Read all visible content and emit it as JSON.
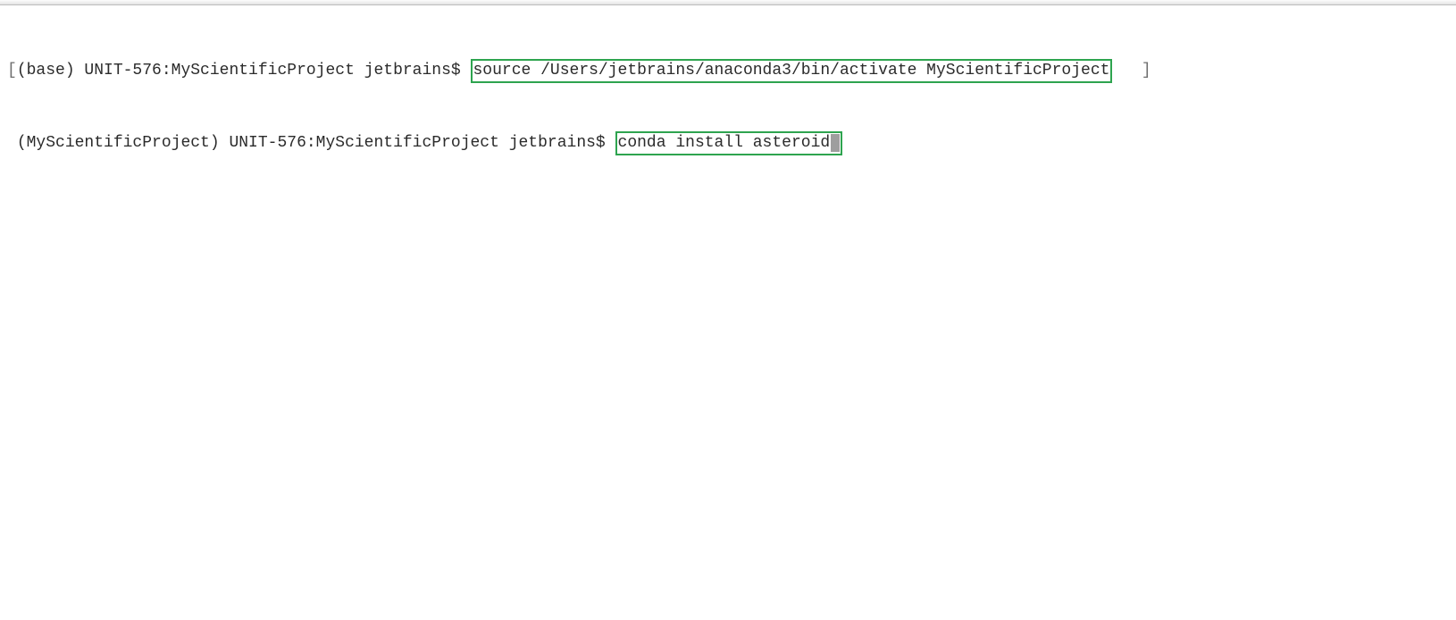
{
  "lines": [
    {
      "open_bracket": "[",
      "prompt": "(base) UNIT-576:MyScientificProject jetbrains$ ",
      "command": "source /Users/jetbrains/anaconda3/bin/activate MyScientificProject",
      "close_bracket": "]",
      "has_box": true,
      "right_bracket_gap": "   "
    },
    {
      "open_bracket": " ",
      "prompt": "(MyScientificProject) UNIT-576:MyScientificProject jetbrains$ ",
      "command": "conda install asteroid",
      "close_bracket": "",
      "has_box": true,
      "has_cursor": true
    }
  ]
}
